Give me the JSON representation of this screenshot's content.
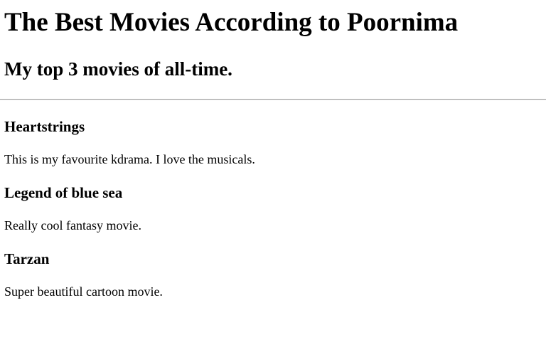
{
  "page": {
    "title": "The Best Movies According to Poornima",
    "subtitle": "My top 3 movies of all-time."
  },
  "movies": [
    {
      "name": "Heartstrings",
      "description": "This is my favourite kdrama. I love the musicals."
    },
    {
      "name": "Legend of blue sea",
      "description": "Really cool fantasy movie."
    },
    {
      "name": "Tarzan",
      "description": "Super beautiful cartoon movie."
    }
  ]
}
